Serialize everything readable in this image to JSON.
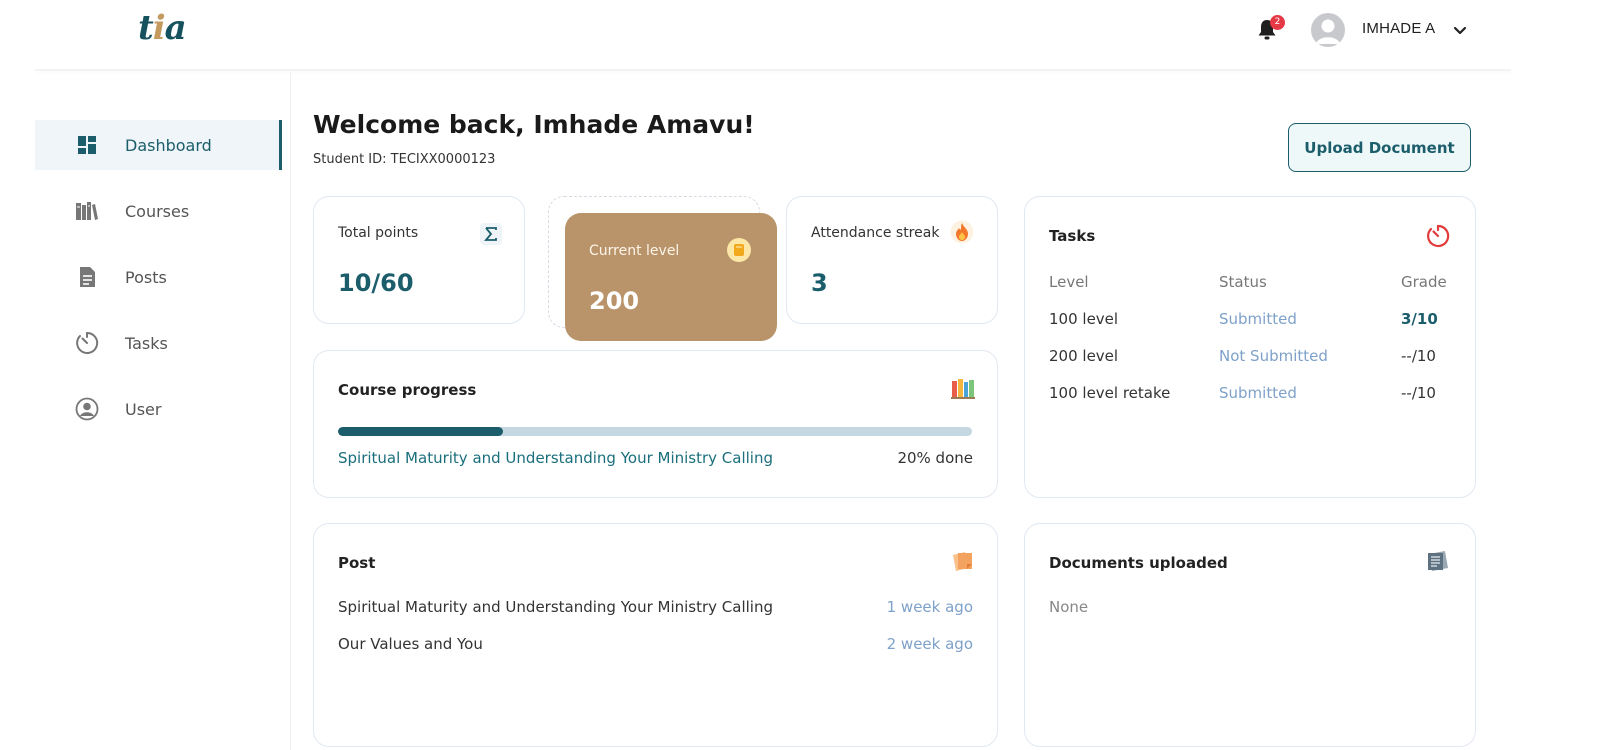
{
  "header": {
    "logo": {
      "t": "t",
      "i": "i",
      "a": "a"
    },
    "notifications": {
      "count": "2",
      "icon": "bell-icon"
    },
    "user": {
      "name": "IMHADE A",
      "avatar_icon": "user-avatar-icon",
      "chevron_icon": "chevron-down-icon"
    }
  },
  "sidebar": {
    "items": [
      {
        "label": "Dashboard",
        "icon": "dashboard-icon",
        "active": true
      },
      {
        "label": "Courses",
        "icon": "books-icon",
        "active": false
      },
      {
        "label": "Posts",
        "icon": "document-icon",
        "active": false
      },
      {
        "label": "Tasks",
        "icon": "timer-icon",
        "active": false
      },
      {
        "label": "User",
        "icon": "user-circle-icon",
        "active": false
      }
    ]
  },
  "main": {
    "welcome": "Welcome back, Imhade Amavu!",
    "student_id": "Student ID: TECIXX0000123",
    "upload_button": "Upload Document",
    "stats": {
      "total_points": {
        "label": "Total points",
        "value": "10/60",
        "icon": "sigma-icon"
      },
      "current_level": {
        "label": "Current level",
        "value": "200",
        "icon": "coin-icon"
      },
      "attendance": {
        "label": "Attendance streak",
        "value": "3",
        "icon": "fire-icon"
      }
    },
    "course_progress": {
      "title": "Course progress",
      "icon": "books-stack-icon",
      "course": "Spiritual Maturity and Understanding Your Ministry Calling",
      "percent_label": "20% done",
      "percent": 26
    },
    "tasks": {
      "title": "Tasks",
      "icon": "timer-red-icon",
      "columns": [
        "Level",
        "Status",
        "Grade"
      ],
      "rows": [
        {
          "level": "100 level",
          "status": "Submitted",
          "grade": "3/10"
        },
        {
          "level": "200 level",
          "status": "Not Submitted",
          "grade": "--/10"
        },
        {
          "level": "100 level retake",
          "status": "Submitted",
          "grade": "--/10"
        }
      ]
    },
    "posts": {
      "title": "Post",
      "icon": "notes-icon",
      "items": [
        {
          "title": "Spiritual Maturity and Understanding Your Ministry Calling",
          "time": "1 week ago"
        },
        {
          "title": "Our Values and You",
          "time": "2 week ago"
        }
      ]
    },
    "documents": {
      "title": "Documents uploaded",
      "icon": "notebook-icon",
      "empty_text": "None"
    }
  },
  "colors": {
    "primary": "#1b5d6b",
    "level_card": "#b9946a",
    "status_link": "#7ea1c9",
    "badge": "#e53945"
  }
}
